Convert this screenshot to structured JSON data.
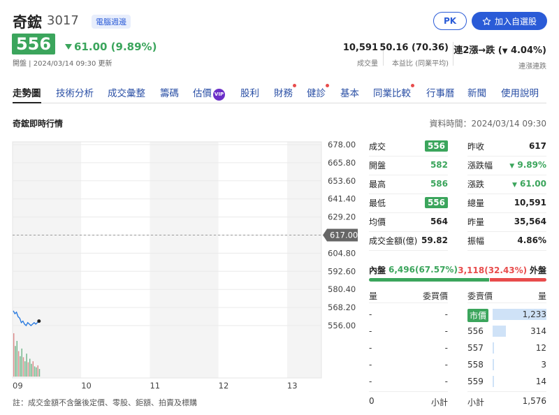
{
  "header": {
    "name": "奇鋐",
    "code": "3017",
    "tag": "電腦週邊",
    "pk_label": "PK",
    "add_label": "加入自選股",
    "price": "556",
    "change": "61.00 (9.89%)",
    "open_info": "開盤 | 2024/03/14 09:30 更新",
    "stats": [
      {
        "value": "10,591",
        "label": "成交量"
      },
      {
        "value": "50.16 (70.36)",
        "label": "本益比 (同業平均)"
      },
      {
        "value_prefix": "連2漲→跌 (",
        "value_arrow": "▼",
        "value_suffix": " 4.04%)",
        "label": "連漲連跌"
      }
    ]
  },
  "tabs": [
    {
      "label": "走勢圖",
      "active": true
    },
    {
      "label": "技術分析"
    },
    {
      "label": "成交彙整"
    },
    {
      "label": "籌碼"
    },
    {
      "label": "估價",
      "vip": "VIP"
    },
    {
      "label": "股利"
    },
    {
      "label": "財務",
      "dot": true
    },
    {
      "label": "健診",
      "dot": true
    },
    {
      "label": "基本"
    },
    {
      "label": "同業比較",
      "dot": true
    },
    {
      "label": "行事曆"
    },
    {
      "label": "新聞"
    },
    {
      "label": "使用說明"
    }
  ],
  "section": {
    "title": "奇鋐即時行情",
    "data_time": "資料時間：2024/03/14 09:30"
  },
  "chart_data": {
    "type": "line",
    "y_ticks": [
      "678.00",
      "665.80",
      "653.60",
      "641.40",
      "629.20",
      "617.00",
      "604.80",
      "592.60",
      "580.40",
      "568.20",
      "556.00"
    ],
    "ylim": [
      556.0,
      678.0
    ],
    "ref_price": "617.00",
    "x_ticks": [
      "09",
      "10",
      "11",
      "12",
      "13"
    ],
    "price_series": [
      566,
      564,
      565,
      562,
      561,
      558,
      559,
      557,
      556,
      558,
      557,
      556,
      557,
      558,
      557,
      558,
      559
    ],
    "volume_series": [
      85,
      60,
      70,
      50,
      40,
      55,
      38,
      30,
      45,
      28,
      35,
      25,
      30,
      20,
      18,
      22,
      15
    ]
  },
  "note": "註：成交金額不含盤後定價、零股、鉅額、拍賣及標購",
  "quote": {
    "left": [
      {
        "label": "成交",
        "value": "556",
        "style": "box"
      },
      {
        "label": "開盤",
        "value": "582",
        "style": "green"
      },
      {
        "label": "最高",
        "value": "586",
        "style": "green"
      },
      {
        "label": "最低",
        "value": "556",
        "style": "box"
      },
      {
        "label": "均價",
        "value": "564",
        "style": "plain"
      },
      {
        "label": "成交金額(億)",
        "value": "59.82",
        "style": "plain"
      }
    ],
    "right": [
      {
        "label": "昨收",
        "value": "617",
        "style": "plain"
      },
      {
        "label": "漲跌幅",
        "value": "9.89%",
        "style": "green-arrow"
      },
      {
        "label": "漲跌",
        "value": "61.00",
        "style": "green-arrow"
      },
      {
        "label": "總量",
        "value": "10,591",
        "style": "plain"
      },
      {
        "label": "昨量",
        "value": "35,564",
        "style": "plain"
      },
      {
        "label": "振幅",
        "value": "4.86%",
        "style": "plain"
      }
    ]
  },
  "inout": {
    "inner_label": "內盤",
    "inner_value": "6,496(67.57%)",
    "inner_ratio": 0.6757,
    "outer_value": "3,118(32.43%)",
    "outer_label": "外盤"
  },
  "orderbook": {
    "headers": [
      "量",
      "委買價",
      "委賣價",
      "量"
    ],
    "bids": [
      {
        "qty": "-",
        "price": "-"
      },
      {
        "qty": "-",
        "price": "-"
      },
      {
        "qty": "-",
        "price": "-"
      },
      {
        "qty": "-",
        "price": "-"
      },
      {
        "qty": "-",
        "price": "-"
      }
    ],
    "asks": [
      {
        "price": "市價",
        "qty": "1,233",
        "ratio": 1.0,
        "market": true
      },
      {
        "price": "556",
        "qty": "314",
        "ratio": 0.25
      },
      {
        "price": "557",
        "qty": "12",
        "ratio": 0.01
      },
      {
        "price": "558",
        "qty": "3",
        "ratio": 0.005
      },
      {
        "price": "559",
        "qty": "14",
        "ratio": 0.012
      }
    ],
    "footer": {
      "bid_total": "0",
      "bid_label": "小計",
      "ask_label": "小計",
      "ask_total": "1,576"
    }
  }
}
